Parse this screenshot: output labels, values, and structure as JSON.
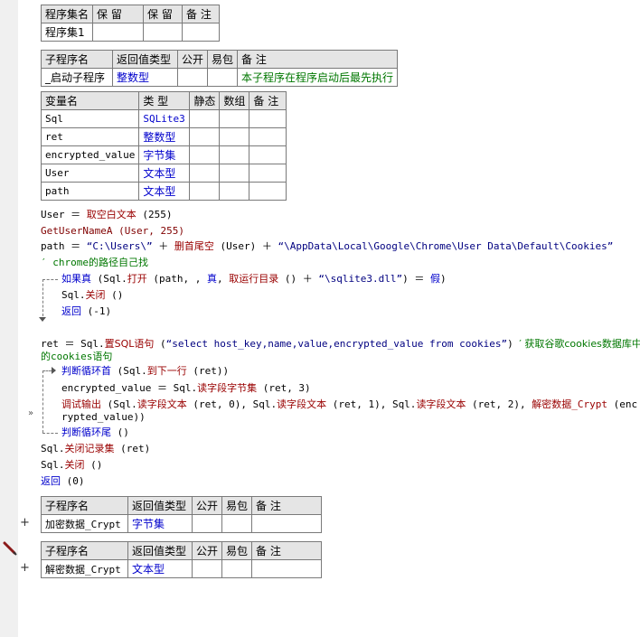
{
  "table1": {
    "headers": [
      "程序集名",
      "保 留",
      "保 留",
      "备 注"
    ],
    "row": [
      "程序集1",
      "",
      "",
      ""
    ]
  },
  "table2": {
    "headers": [
      "子程序名",
      "返回值类型",
      "公开",
      "易包",
      "备 注"
    ],
    "row": [
      "_启动子程序",
      "整数型",
      "",
      "",
      "本子程序在程序启动后最先执行"
    ]
  },
  "table3": {
    "headers": [
      "变量名",
      "类 型",
      "静态",
      "数组",
      "备 注"
    ],
    "rows": [
      [
        "Sql",
        "SQLite3"
      ],
      [
        "ret",
        "整数型"
      ],
      [
        "encrypted_value",
        "字节集"
      ],
      [
        "User",
        "文本型"
      ],
      [
        "path",
        "文本型"
      ]
    ]
  },
  "code": {
    "l1a": "User ＝ ",
    "l1b": "取空白文本",
    "l1c": " (255)",
    "l2": "GetUserNameA (User, 255)",
    "l3a": "path ＝ ",
    "l3b": "“C:\\Users\\”",
    "l3c": " ＋ ",
    "l3d": "删首尾空",
    "l3e": " (User) ＋ ",
    "l3f": "“\\AppData\\Local\\Google\\Chrome\\User Data\\Default\\Cookies”",
    "l4": "′ chrome的路径自己找",
    "l5a": "如果真",
    "l5b": " (Sql.",
    "l5c": "打开",
    "l5d": " (path, , ",
    "l5e": "真",
    "l5f": ", ",
    "l5g": "取运行目录",
    "l5h": " () ＋ ",
    "l5i": "“\\sqlite3.dll”",
    "l5j": ") ＝ ",
    "l5k": "假",
    "l5l": ")",
    "l6a": "Sql.",
    "l6b": "关闭",
    "l6c": " ()",
    "l7a": "返回",
    "l7b": " (-1)",
    "l8a": "ret ＝ Sql.",
    "l8b": "置SQL语句",
    "l8c": " (",
    "l8d": "“select host_key,name,value,encrypted_value from cookies”",
    "l8e": ")  ",
    "l8f": "′ 获取谷歌cookies数据库中",
    "l9": "的cookies语句",
    "l10a": "判断循环首",
    "l10b": " (Sql.",
    "l10c": "到下一行",
    "l10d": " (ret))",
    "l11a": "encrypted_value ＝ Sql.",
    "l11b": "读字段字节集",
    "l11c": " (ret, 3)",
    "l12a": "调试输出",
    "l12b": " (Sql.",
    "l12c": "读字段文本",
    "l12d": " (ret, 0), Sql.",
    "l12e": "读字段文本",
    "l12f": " (ret, 1), Sql.",
    "l12g": "读字段文本",
    "l12h": " (ret, 2), ",
    "l12i": "解密数据_Crypt",
    "l12j": " (enc",
    "l13": "rypted_value))",
    "l14a": "判断循环尾",
    "l14b": " ()",
    "l15a": "Sql.",
    "l15b": "关闭记录集",
    "l15c": " (ret)",
    "l16a": "Sql.",
    "l16b": "关闭",
    "l16c": " ()",
    "l17a": "返回",
    "l17b": " (0)"
  },
  "table4": {
    "headers": [
      "子程序名",
      "返回值类型",
      "公开",
      "易包",
      "备 注"
    ],
    "row": [
      "加密数据_Crypt",
      "字节集",
      "",
      "",
      ""
    ]
  },
  "table5": {
    "headers": [
      "子程序名",
      "返回值类型",
      "公开",
      "易包",
      "备 注"
    ],
    "row": [
      "解密数据_Crypt",
      "文本型",
      "",
      "",
      ""
    ]
  },
  "gutter": {
    "plus1": "+",
    "plus2": "+",
    "marker": "»"
  }
}
